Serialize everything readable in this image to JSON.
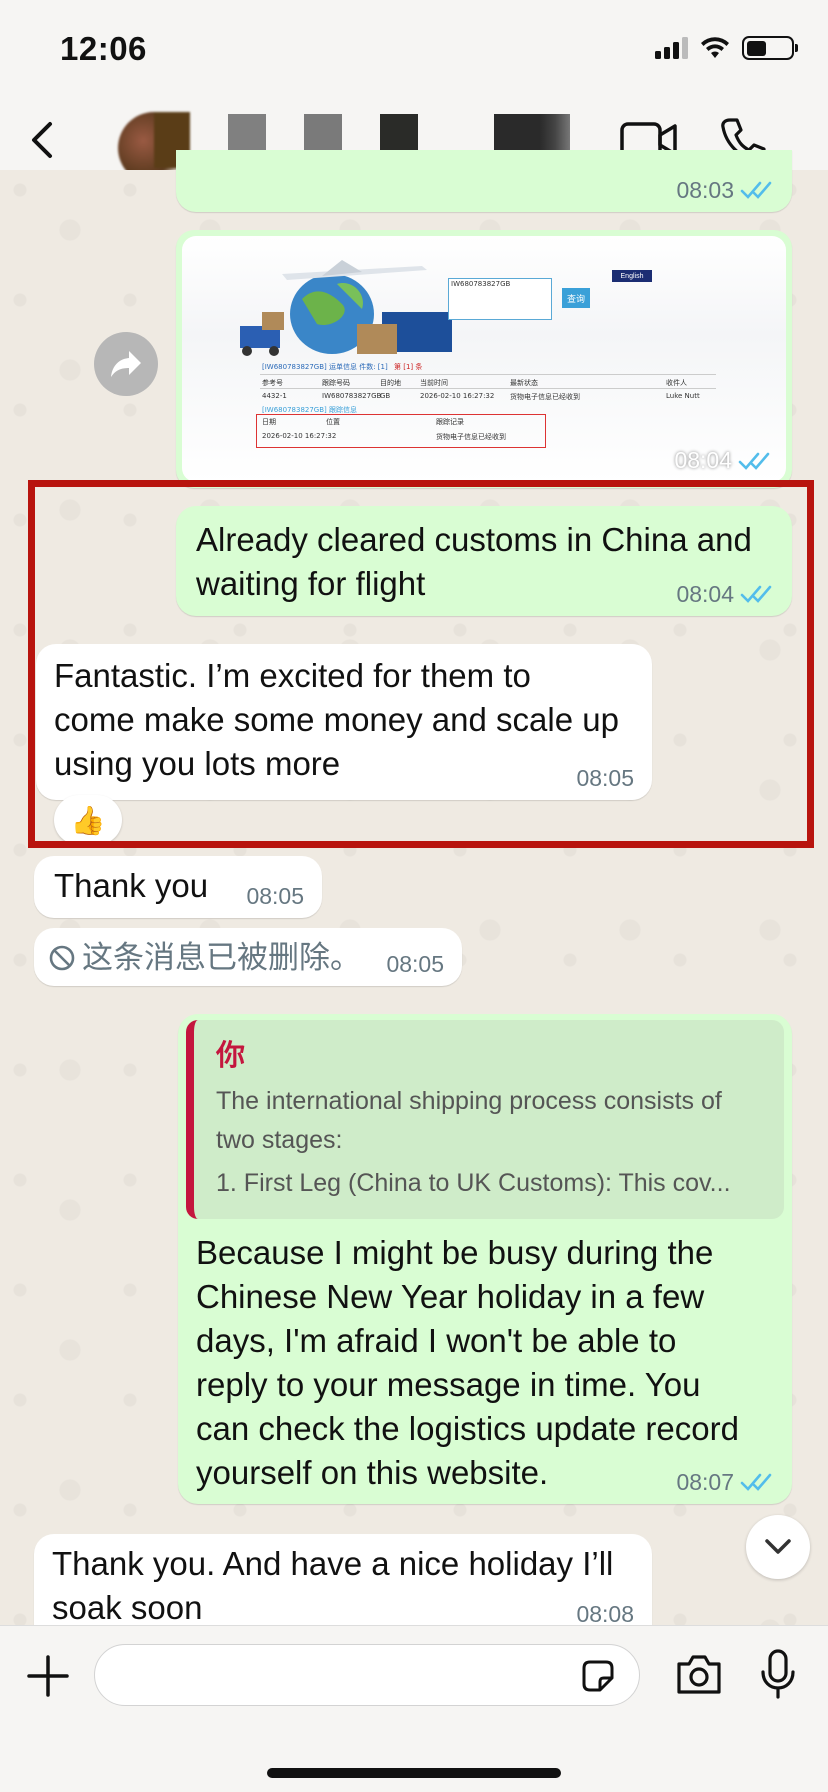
{
  "status_bar": {
    "time": "12:06"
  },
  "header": {
    "back_icon": "chevron-left-icon",
    "video_icon": "video-camera-icon",
    "phone_icon": "phone-icon"
  },
  "messages": {
    "top_partial": {
      "time": "08:03"
    },
    "image_message": {
      "time": "08:04",
      "image_texts": {
        "tracking_input": "IW680783827GB",
        "query_button": "查询",
        "english_button": "English",
        "result_header": "[IW680783827GB] 运单信息  件数: [1]",
        "result_count": "第 [1] 条",
        "col_ref": "参考号",
        "col_tracking": "跟踪号码",
        "col_dest": "目的地",
        "col_time": "当前时间",
        "col_status": "最新状态",
        "col_receiver": "收件人",
        "row_ref": "4432-1",
        "row_tracking": "IW680783827GB",
        "row_dest": "GB",
        "row_time": "2026-02-10 16:27:32",
        "row_status": "货物电子信息已经收到",
        "row_receiver": "Luke Nutt",
        "sub_header": "[IW680783827GB] 跟踪信息",
        "col_date": "日期",
        "col_location": "位置",
        "col_record": "跟踪记录",
        "rec_date": "2026-02-10 16:27:32",
        "rec_text": "货物电子信息已经收到"
      }
    },
    "msg_customs": {
      "text_line1": "Already cleared customs in China and",
      "text_line2": "waiting for flight",
      "time": "08:04"
    },
    "msg_fantastic": {
      "line1": "Fantastic. I’m excited for them to",
      "line2": "come make some money and scale up",
      "line3": "using you lots more",
      "time": "08:05",
      "reaction": "👍"
    },
    "msg_thankyou": {
      "text": "Thank you",
      "time": "08:05"
    },
    "msg_deleted": {
      "text": "这条消息已被删除。",
      "time": "08:05"
    },
    "msg_holiday": {
      "quote_author": "你",
      "quote_text": "The international shipping process consists of two stages:",
      "quote_line2": "1. First Leg (China to UK Customs): This cov...",
      "line1": "Because I might be busy during the",
      "line2": "Chinese New Year holiday in a few",
      "line3": "days, I'm afraid I won't be able to",
      "line4": "reply to your message in time. You",
      "line5": "can check the logistics update record",
      "line6": "yourself on this website.",
      "time": "08:07"
    },
    "msg_last": {
      "line1": "Thank you. And have a nice holiday I’ll",
      "line2": "soak soon",
      "time": "08:08"
    }
  },
  "composer": {
    "placeholder": ""
  },
  "colors": {
    "outgoing_bubble": "#d9fdd3",
    "incoming_bubble": "#ffffff",
    "highlight": "#b8140e",
    "read_ticks": "#53bdeb",
    "quote_accent": "#c4163e"
  }
}
